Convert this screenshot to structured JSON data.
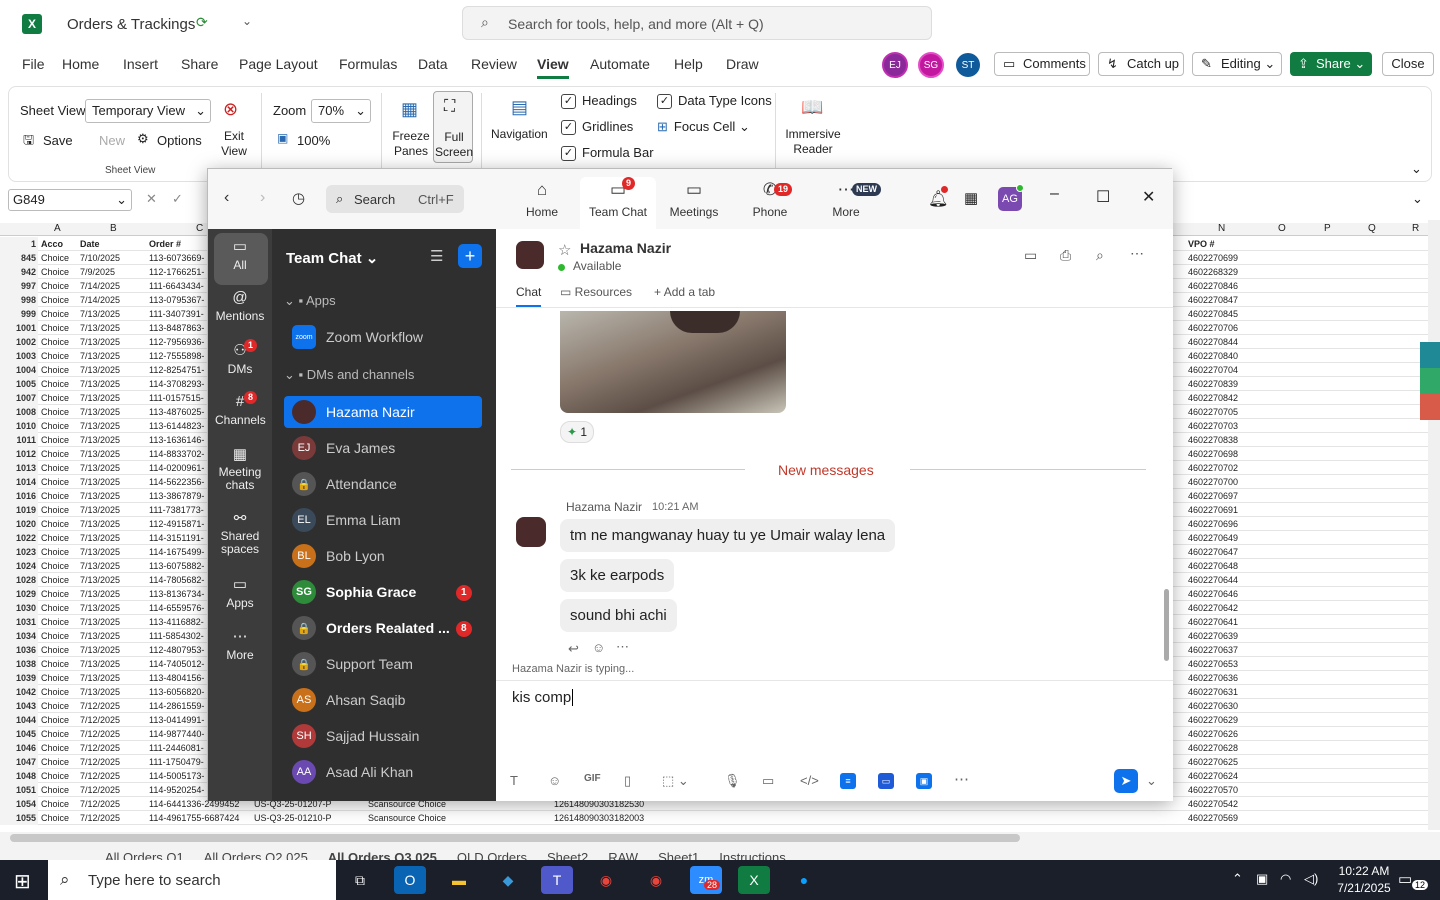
{
  "excel": {
    "doc_title": "Orders & Trackings",
    "search_placeholder": "Search for tools, help, and more (Alt + Q)",
    "menu": [
      "File",
      "Home",
      "Insert",
      "Share",
      "Page Layout",
      "Formulas",
      "Data",
      "Review",
      "View",
      "Automate",
      "Help",
      "Draw"
    ],
    "active_menu": "View",
    "avatars": [
      {
        "initials": "EJ",
        "color": "#8a2a9a"
      },
      {
        "initials": "SG",
        "color": "#c2189f"
      },
      {
        "initials": "ST",
        "color": "#0f5a9a"
      }
    ],
    "buttons": {
      "comments": "Comments",
      "catch_up": "Catch up",
      "editing": "Editing",
      "share": "Share",
      "close": "Close"
    },
    "ribbon": {
      "sheet_view_label": "Sheet View",
      "sheet_view_value": "Temporary View",
      "save": "Save",
      "new": "New",
      "options": "Options",
      "exit_view": "Exit View",
      "group_sheet_view": "Sheet View",
      "zoom_label": "Zoom",
      "zoom_value": "70%",
      "zoom_100": "100%",
      "freeze_panes": "Freeze Panes",
      "full_screen": "Full Screen",
      "navigation": "Navigation",
      "headings": "Headings",
      "gridlines": "Gridlines",
      "formula_bar": "Formula Bar",
      "data_type_icons": "Data Type Icons",
      "focus_cell": "Focus Cell",
      "immersive_reader": "Immersive Reader"
    },
    "name_box": "G849",
    "col_headers": [
      "A",
      "B",
      "C",
      "N",
      "O",
      "P",
      "Q",
      "R"
    ],
    "header_row": {
      "num": "1",
      "a": "Acco",
      "b": "Date",
      "c": "Order #",
      "n": "VPO #"
    },
    "rows": [
      {
        "n": "845",
        "a": "Choice",
        "b": "7/10/2025",
        "c": "113-6073669-",
        "v": "4602270699"
      },
      {
        "n": "942",
        "a": "Choice",
        "b": "7/9/2025",
        "c": "112-1766251-",
        "v": "4602268329"
      },
      {
        "n": "997",
        "a": "Choice",
        "b": "7/14/2025",
        "c": "111-6643434-",
        "v": "4602270846"
      },
      {
        "n": "998",
        "a": "Choice",
        "b": "7/14/2025",
        "c": "113-0795367-",
        "v": "4602270847"
      },
      {
        "n": "999",
        "a": "Choice",
        "b": "7/13/2025",
        "c": "111-3407391-",
        "v": "4602270845"
      },
      {
        "n": "1001",
        "a": "Choice",
        "b": "7/13/2025",
        "c": "113-8487863-",
        "v": "4602270706"
      },
      {
        "n": "1002",
        "a": "Choice",
        "b": "7/13/2025",
        "c": "112-7956936-",
        "v": "4602270844"
      },
      {
        "n": "1003",
        "a": "Choice",
        "b": "7/13/2025",
        "c": "112-7555898-",
        "v": "4602270840"
      },
      {
        "n": "1004",
        "a": "Choice",
        "b": "7/13/2025",
        "c": "112-8254751-",
        "v": "4602270704"
      },
      {
        "n": "1005",
        "a": "Choice",
        "b": "7/13/2025",
        "c": "114-3708293-",
        "v": "4602270839"
      },
      {
        "n": "1007",
        "a": "Choice",
        "b": "7/13/2025",
        "c": "111-0157515-",
        "v": "4602270842"
      },
      {
        "n": "1008",
        "a": "Choice",
        "b": "7/13/2025",
        "c": "113-4876025-",
        "v": "4602270705"
      },
      {
        "n": "1010",
        "a": "Choice",
        "b": "7/13/2025",
        "c": "113-6144823-",
        "v": "4602270703"
      },
      {
        "n": "1011",
        "a": "Choice",
        "b": "7/13/2025",
        "c": "113-1636146-",
        "v": "4602270838"
      },
      {
        "n": "1012",
        "a": "Choice",
        "b": "7/13/2025",
        "c": "114-8833702-",
        "v": "4602270698"
      },
      {
        "n": "1013",
        "a": "Choice",
        "b": "7/13/2025",
        "c": "114-0200961-",
        "v": "4602270702"
      },
      {
        "n": "1014",
        "a": "Choice",
        "b": "7/13/2025",
        "c": "114-5622356-",
        "v": "4602270700"
      },
      {
        "n": "1016",
        "a": "Choice",
        "b": "7/13/2025",
        "c": "113-3867879-",
        "v": "4602270697"
      },
      {
        "n": "1019",
        "a": "Choice",
        "b": "7/13/2025",
        "c": "111-7381773-",
        "v": "4602270691"
      },
      {
        "n": "1020",
        "a": "Choice",
        "b": "7/13/2025",
        "c": "112-4915871-",
        "v": "4602270696"
      },
      {
        "n": "1022",
        "a": "Choice",
        "b": "7/13/2025",
        "c": "114-3151191-",
        "v": "4602270649"
      },
      {
        "n": "1023",
        "a": "Choice",
        "b": "7/13/2025",
        "c": "114-1675499-",
        "v": "4602270647"
      },
      {
        "n": "1024",
        "a": "Choice",
        "b": "7/13/2025",
        "c": "113-6075882-",
        "v": "4602270648"
      },
      {
        "n": "1028",
        "a": "Choice",
        "b": "7/13/2025",
        "c": "114-7805682-",
        "v": "4602270644"
      },
      {
        "n": "1029",
        "a": "Choice",
        "b": "7/13/2025",
        "c": "113-8136734-",
        "v": "4602270646"
      },
      {
        "n": "1030",
        "a": "Choice",
        "b": "7/13/2025",
        "c": "114-6559576-",
        "v": "4602270642"
      },
      {
        "n": "1031",
        "a": "Choice",
        "b": "7/13/2025",
        "c": "113-4116882-",
        "v": "4602270641"
      },
      {
        "n": "1034",
        "a": "Choice",
        "b": "7/13/2025",
        "c": "111-5854302-",
        "v": "4602270639"
      },
      {
        "n": "1036",
        "a": "Choice",
        "b": "7/13/2025",
        "c": "112-4807953-",
        "v": "4602270637"
      },
      {
        "n": "1038",
        "a": "Choice",
        "b": "7/13/2025",
        "c": "114-7405012-",
        "v": "4602270653"
      },
      {
        "n": "1039",
        "a": "Choice",
        "b": "7/13/2025",
        "c": "113-4804156-",
        "v": "4602270636"
      },
      {
        "n": "1042",
        "a": "Choice",
        "b": "7/13/2025",
        "c": "113-6056820-",
        "v": "4602270631"
      },
      {
        "n": "1043",
        "a": "Choice",
        "b": "7/12/2025",
        "c": "114-2861559-",
        "v": "4602270630"
      },
      {
        "n": "1044",
        "a": "Choice",
        "b": "7/12/2025",
        "c": "113-0414991-",
        "v": "4602270629"
      },
      {
        "n": "1045",
        "a": "Choice",
        "b": "7/12/2025",
        "c": "114-9877440-",
        "v": "4602270626"
      },
      {
        "n": "1046",
        "a": "Choice",
        "b": "7/12/2025",
        "c": "111-2446081-",
        "v": "4602270628"
      },
      {
        "n": "1047",
        "a": "Choice",
        "b": "7/12/2025",
        "c": "111-1750479-",
        "v": "4602270625"
      },
      {
        "n": "1048",
        "a": "Choice",
        "b": "7/12/2025",
        "c": "114-5005173-",
        "v": "4602270624"
      },
      {
        "n": "1051",
        "a": "Choice",
        "b": "7/12/2025",
        "c": "114-9520254-",
        "v": "4602270570"
      },
      {
        "n": "1054",
        "a": "Choice",
        "b": "7/12/2025",
        "c": "114-6441336-2499452",
        "v": "4602270542",
        "d": "US-Q3-25-01207-P",
        "e": "Scansource Choice",
        "f": "126148090303182530"
      },
      {
        "n": "1055",
        "a": "Choice",
        "b": "7/12/2025",
        "c": "114-4961755-6687424",
        "v": "4602270569",
        "d": "US-Q3-25-01210-P",
        "e": "Scansource Choice",
        "f": "126148090303182003"
      }
    ],
    "sheet_tabs": [
      "All Orders Q1",
      "All Orders Q2 025",
      "All Orders Q3 025",
      "OLD Orders",
      "Sheet2",
      "RAW",
      "Sheet1",
      "Instructions"
    ]
  },
  "zoom": {
    "search_label": "Search",
    "search_shortcut": "Ctrl+F",
    "top_tabs": [
      {
        "label": "Home",
        "icon": "home-icon",
        "badge": ""
      },
      {
        "label": "Team Chat",
        "icon": "chat-icon",
        "badge": "9"
      },
      {
        "label": "Meetings",
        "icon": "video-icon",
        "badge": ""
      },
      {
        "label": "Phone",
        "icon": "phone-icon",
        "badge": "19"
      },
      {
        "label": "More",
        "icon": "more-icon",
        "badge": "NEW"
      }
    ],
    "user_initials": "AG",
    "rail": [
      {
        "label": "All",
        "icon": "chat-bubble-icon",
        "badge": ""
      },
      {
        "label": "Mentions",
        "icon": "at-icon",
        "badge": ""
      },
      {
        "label": "DMs",
        "icon": "people-icon",
        "badge": "1"
      },
      {
        "label": "Channels",
        "icon": "hash-icon",
        "badge": "8"
      },
      {
        "label": "Meeting chats",
        "icon": "calendar-icon",
        "badge": ""
      },
      {
        "label": "Shared spaces",
        "icon": "share-icon",
        "badge": ""
      },
      {
        "label": "Apps",
        "icon": "apps-icon",
        "badge": ""
      },
      {
        "label": "More",
        "icon": "ellipsis-icon",
        "badge": ""
      }
    ],
    "list_title": "Team Chat",
    "sections": {
      "apps": "Apps",
      "dms": "DMs and channels"
    },
    "app_item": "Zoom Workflow",
    "contacts": [
      {
        "name": "Hazama Nazir",
        "initials": "",
        "color": "#4a2a2a",
        "badge": "",
        "selected": true,
        "bold": false
      },
      {
        "name": "Eva James",
        "initials": "EJ",
        "color": "#7a3a3a",
        "badge": "",
        "selected": false,
        "bold": false
      },
      {
        "name": "Attendance",
        "initials": "🔒",
        "color": "#555",
        "badge": "",
        "selected": false,
        "bold": false
      },
      {
        "name": "Emma Liam",
        "initials": "EL",
        "color": "#3a4a5a",
        "badge": "",
        "selected": false,
        "bold": false
      },
      {
        "name": "Bob Lyon",
        "initials": "BL",
        "color": "#c8701a",
        "badge": "",
        "selected": false,
        "bold": false
      },
      {
        "name": "Sophia Grace",
        "initials": "SG",
        "color": "#2e8b3a",
        "badge": "1",
        "selected": false,
        "bold": true
      },
      {
        "name": "Orders Realated ...",
        "initials": "🔒",
        "color": "#555",
        "badge": "8",
        "selected": false,
        "bold": true
      },
      {
        "name": "Support Team",
        "initials": "🔒",
        "color": "#555",
        "badge": "",
        "selected": false,
        "bold": false
      },
      {
        "name": "Ahsan Saqib",
        "initials": "AS",
        "color": "#c8701a",
        "badge": "",
        "selected": false,
        "bold": false
      },
      {
        "name": "Sajjad Hussain",
        "initials": "SH",
        "color": "#b03a3a",
        "badge": "",
        "selected": false,
        "bold": false
      },
      {
        "name": "Asad Ali Khan",
        "initials": "AA",
        "color": "#6a4ab0",
        "badge": "",
        "selected": false,
        "bold": false
      }
    ],
    "chat": {
      "name": "Hazama Nazir",
      "status": "Available",
      "tabs": [
        "Chat",
        "Resources",
        "Add a tab"
      ],
      "reaction_count": "1",
      "new_messages": "New messages",
      "sender": "Hazama Nazir",
      "time": "10:21 AM",
      "messages": [
        "tm ne mangwanay huay tu ye Umair walay lena",
        "3k ke earpods",
        "sound bhi achi"
      ],
      "typing": "Hazama Nazir  is typing...",
      "compose_value": "kis comp"
    }
  },
  "taskbar": {
    "search_placeholder": "Type here to search",
    "time": "10:22 AM",
    "date": "7/21/2025",
    "notif_count": "12",
    "zoom_badge": "28"
  },
  "colors": {
    "excel_green": "#107c41",
    "zoom_blue": "#0e72ed",
    "badge_red": "#e02828"
  }
}
